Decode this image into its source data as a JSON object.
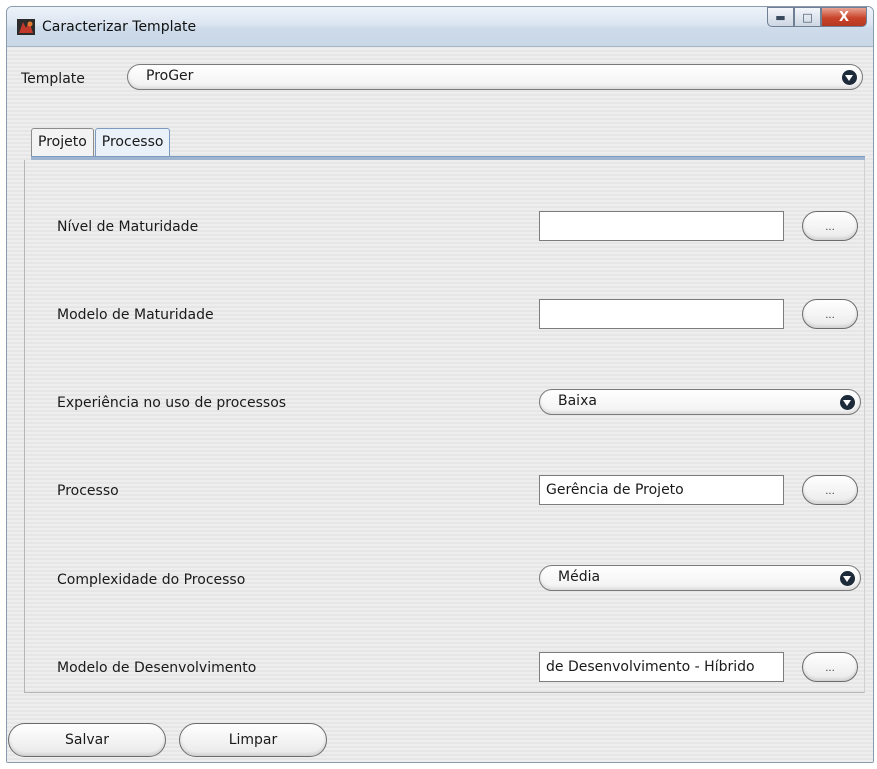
{
  "window": {
    "title": "Caracterizar Template",
    "icon": "app-logo-icon",
    "controls": {
      "minimize_icon": "minimize-icon",
      "maximize_icon": "maximize-icon",
      "close_label": "X"
    }
  },
  "template": {
    "label": "Template",
    "selected": "ProGer"
  },
  "tabs": [
    {
      "label": "Projeto",
      "active": false
    },
    {
      "label": "Processo",
      "active": true
    }
  ],
  "fields": {
    "nivel_maturidade": {
      "label": "Nível de Maturidade",
      "value": "",
      "button": "..."
    },
    "modelo_maturidade": {
      "label": "Modelo de Maturidade",
      "value": "",
      "button": "..."
    },
    "experiencia": {
      "label": "Experiência no uso de processos",
      "selected": "Baixa"
    },
    "processo": {
      "label": "Processo",
      "value": "Gerência de Projeto",
      "button": "..."
    },
    "complexidade": {
      "label": "Complexidade do Processo",
      "selected": "Média"
    },
    "modelo_desenvolvimento": {
      "label": "Modelo de Desenvolvimento",
      "value": "de Desenvolvimento - Híbrido",
      "button": "..."
    }
  },
  "actions": {
    "save_label": "Salvar",
    "clear_label": "Limpar"
  },
  "colors": {
    "titlebar": "#dbe5f1",
    "close_button": "#c9452a",
    "active_tab": "#eaf1f9"
  }
}
